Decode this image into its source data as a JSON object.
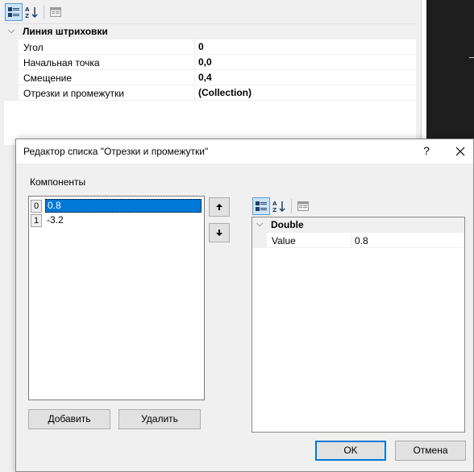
{
  "background_grid": {
    "category": "Линия штриховки",
    "properties": [
      {
        "name": "Угол",
        "value": "0"
      },
      {
        "name": "Начальная точка",
        "value": "0,0"
      },
      {
        "name": "Смещение",
        "value": "0,4"
      },
      {
        "name": "Отрезки и промежутки",
        "value": "(Collection)"
      }
    ],
    "toolbar_icons": [
      "categorized-icon",
      "alphabetical-sort-icon",
      "property-pages-icon"
    ]
  },
  "dialog": {
    "title": "Редактор списка \"Отрезки и промежутки\"",
    "help_label": "?",
    "components_label": "Компоненты",
    "items": [
      {
        "index": "0",
        "value": "0.8",
        "selected": true
      },
      {
        "index": "1",
        "value": "-3.2",
        "selected": false
      }
    ],
    "add_label": "Добавить",
    "remove_label": "Удалить",
    "ok_label": "OK",
    "cancel_label": "Отмена",
    "properties": {
      "category": "Double",
      "rows": [
        {
          "name": "Value",
          "value": "0.8"
        }
      ]
    }
  },
  "colors": {
    "selection": "#0078d7",
    "active_toolbar": "#cce4f7",
    "editor_background": "#1e1e1e"
  }
}
